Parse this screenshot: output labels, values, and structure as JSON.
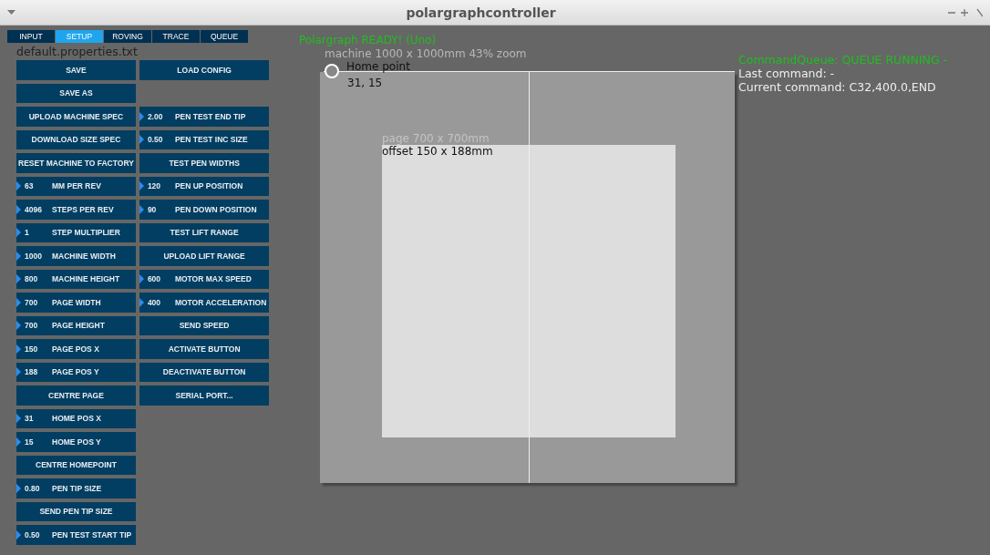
{
  "window": {
    "title": "polargraphcontroller"
  },
  "tabs": [
    {
      "label": "INPUT",
      "selected": false
    },
    {
      "label": "SETUP",
      "selected": true
    },
    {
      "label": "ROVING",
      "selected": false
    },
    {
      "label": "TRACE",
      "selected": false
    },
    {
      "label": "QUEUE",
      "selected": false
    }
  ],
  "filename": "default.properties.txt",
  "rows": [
    {
      "left": {
        "kind": "button",
        "label": "SAVE"
      },
      "right": {
        "kind": "button",
        "label": "LOAD CONFIG"
      }
    },
    {
      "left": {
        "kind": "button",
        "label": "SAVE AS"
      }
    },
    {
      "left": {
        "kind": "button",
        "label": "UPLOAD MACHINE SPEC"
      },
      "right": {
        "kind": "field",
        "value": "2.00",
        "label": "PEN TEST END TIP"
      }
    },
    {
      "left": {
        "kind": "button",
        "label": "DOWNLOAD SIZE SPEC"
      },
      "right": {
        "kind": "field",
        "value": "0.50",
        "label": "PEN TEST INC SIZE"
      }
    },
    {
      "left": {
        "kind": "button",
        "label": "RESET MACHINE TO FACTORY"
      },
      "right": {
        "kind": "button",
        "label": "TEST PEN WIDTHS"
      }
    },
    {
      "left": {
        "kind": "field",
        "value": "63",
        "label": "MM PER REV"
      },
      "right": {
        "kind": "field",
        "value": "120",
        "label": "PEN UP POSITION"
      }
    },
    {
      "left": {
        "kind": "field",
        "value": "4096",
        "label": "STEPS PER REV"
      },
      "right": {
        "kind": "field",
        "value": "90",
        "label": "PEN DOWN POSITION"
      }
    },
    {
      "left": {
        "kind": "field",
        "value": "1",
        "label": "STEP MULTIPLIER"
      },
      "right": {
        "kind": "button",
        "label": "TEST LIFT RANGE"
      }
    },
    {
      "left": {
        "kind": "field",
        "value": "1000",
        "label": "MACHINE WIDTH"
      },
      "right": {
        "kind": "button",
        "label": "UPLOAD LIFT RANGE"
      }
    },
    {
      "left": {
        "kind": "field",
        "value": "800",
        "label": "MACHINE HEIGHT"
      },
      "right": {
        "kind": "field",
        "value": "600",
        "label": "MOTOR MAX SPEED"
      }
    },
    {
      "left": {
        "kind": "field",
        "value": "700",
        "label": "PAGE WIDTH"
      },
      "right": {
        "kind": "field",
        "value": "400",
        "label": "MOTOR ACCELERATION"
      }
    },
    {
      "left": {
        "kind": "field",
        "value": "700",
        "label": "PAGE HEIGHT"
      },
      "right": {
        "kind": "button",
        "label": "SEND SPEED"
      }
    },
    {
      "left": {
        "kind": "field",
        "value": "150",
        "label": "PAGE POS X"
      },
      "right": {
        "kind": "button",
        "label": "ACTIVATE BUTTON"
      }
    },
    {
      "left": {
        "kind": "field",
        "value": "188",
        "label": "PAGE POS Y"
      },
      "right": {
        "kind": "button",
        "label": "DEACTIVATE BUTTON"
      }
    },
    {
      "left": {
        "kind": "button",
        "label": "CENTRE PAGE"
      },
      "right": {
        "kind": "button",
        "label": "SERIAL PORT..."
      }
    },
    {
      "left": {
        "kind": "field",
        "value": "31",
        "label": "HOME POS X"
      }
    },
    {
      "left": {
        "kind": "field",
        "value": "15",
        "label": "HOME POS Y"
      }
    },
    {
      "left": {
        "kind": "button",
        "label": "CENTRE HOMEPOINT"
      }
    },
    {
      "left": {
        "kind": "field",
        "value": "0.80",
        "label": "PEN TIP SIZE"
      }
    },
    {
      "left": {
        "kind": "button",
        "label": "SEND PEN TIP SIZE"
      }
    },
    {
      "left": {
        "kind": "field",
        "value": "0.50",
        "label": "PEN TEST START TIP"
      }
    }
  ],
  "status": "Polargraph READY! (Uno)",
  "canvas": {
    "machine_label": "machine 1000 x 1000mm 43% zoom",
    "home_label": "Home point",
    "home_coords": "31, 15",
    "page_label": "page 700 x 700mm",
    "offset_label": "offset 150 x 188mm"
  },
  "queue": {
    "status": "CommandQueue: QUEUE RUNNING -",
    "last_command": "Last command: -",
    "current_command": "Current command: C32,400.0,END"
  }
}
